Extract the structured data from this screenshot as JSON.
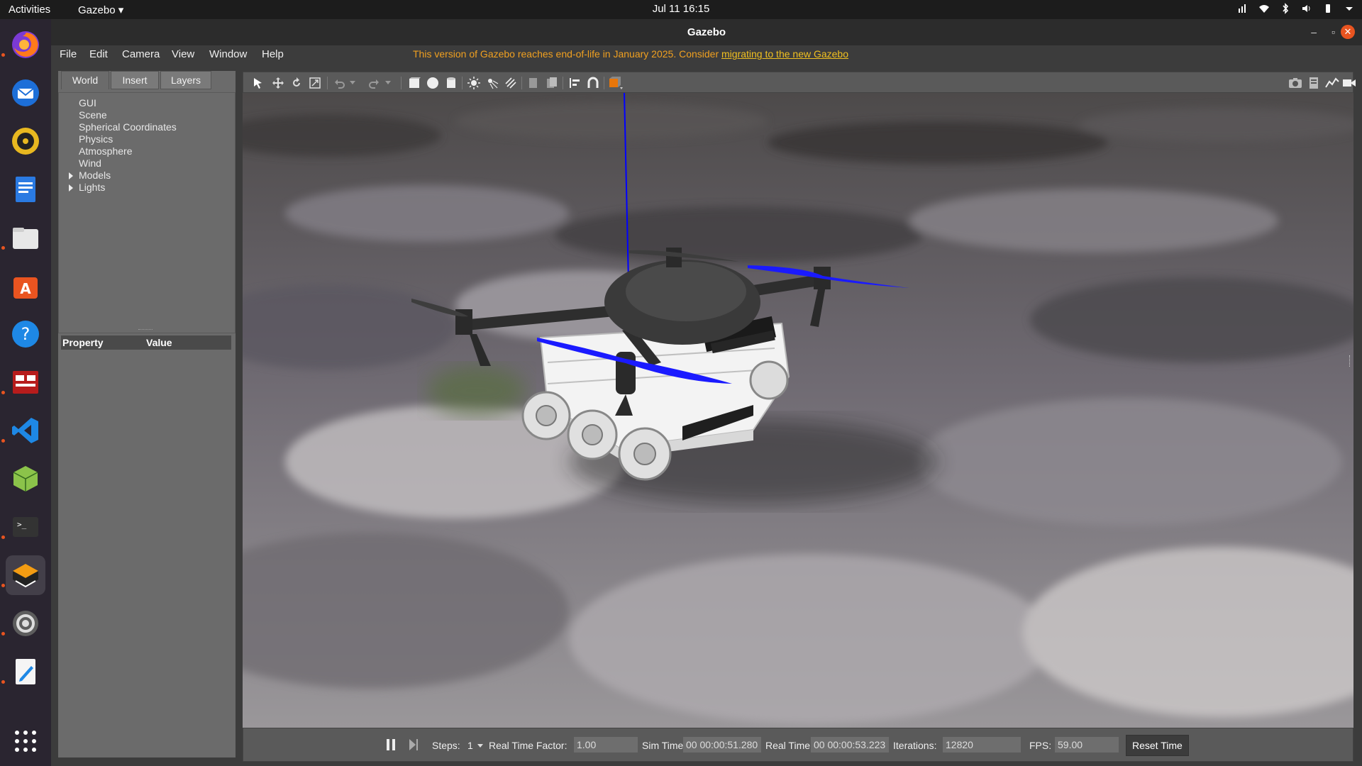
{
  "topbar": {
    "activities": "Activities",
    "app_menu": "Gazebo ▾",
    "clock": "Jul 11  16:15"
  },
  "window": {
    "title": "Gazebo"
  },
  "menu": {
    "file": "File",
    "edit": "Edit",
    "camera": "Camera",
    "view": "View",
    "window": "Window",
    "help": "Help",
    "eol_text": "This version of Gazebo reaches end-of-life in January 2025. Consider ",
    "eol_link": "migrating to the new Gazebo"
  },
  "left_panel": {
    "tabs": [
      "World",
      "Insert",
      "Layers"
    ],
    "tree": [
      "GUI",
      "Scene",
      "Spherical Coordinates",
      "Physics",
      "Atmosphere",
      "Wind",
      "Models",
      "Lights"
    ],
    "props_header": {
      "property": "Property",
      "value": "Value"
    }
  },
  "bottom": {
    "steps_label": "Steps:",
    "steps_value": "1",
    "rtf_label": "Real Time Factor:",
    "rtf_value": "1.00",
    "sim_label": "Sim Time:",
    "sim_value": "00 00:00:51.280",
    "real_label": "Real Time:",
    "real_value": "00 00:00:53.223",
    "iter_label": "Iterations:",
    "iter_value": "12820",
    "fps_label": "FPS:",
    "fps_value": "59.00",
    "reset_label": "Reset Time"
  },
  "colors": {
    "accent": "#e95420",
    "eol": "#f0a020",
    "propeller_blue": "#1a1aff",
    "axis_blue": "#0000ff"
  },
  "dock_icons": [
    "firefox-icon",
    "thunderbird-icon",
    "rhythmbox-icon",
    "writer-icon",
    "files-icon",
    "software-icon",
    "help-icon",
    "terminal-red-icon",
    "vscode-icon",
    "cube-icon",
    "terminal-icon",
    "gazebo-icon",
    "settings-icon",
    "text-editor-icon",
    "apps-grid-icon"
  ]
}
